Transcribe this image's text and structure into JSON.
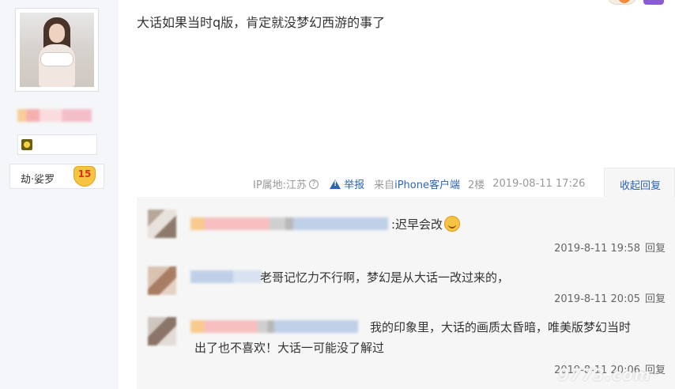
{
  "post": {
    "text": "大话如果当时q版，肯定就没梦幻西游的事了",
    "ip_location": "IP属地:江苏",
    "help_icon": "?",
    "report_label": "举报",
    "from_prefix": "来自",
    "client": "iPhone客户端",
    "floor": "2楼",
    "time": "2019-08-11 17:26",
    "collapse_label": "收起回复"
  },
  "user": {
    "level_name": "劫·娑罗",
    "level": "15",
    "avatar_icon": "user-avatar"
  },
  "replies": [
    {
      "text": ":迟早会改",
      "emoji_icon": "smile-icon",
      "time": "2019-8-11 19:58",
      "reply_label": "回复"
    },
    {
      "text": "老哥记忆力不行啊，梦幻是从大话一改过来的，",
      "time": "2019-8-11 20:05",
      "reply_label": "回复"
    },
    {
      "text_line1": "我的印象里，大话的画质太昏暗，唯美版梦幻当时",
      "text_line2": "出了也不喜欢！大话一可能没了解过",
      "time": "2019-8-11 20:06",
      "reply_label": "回复"
    }
  ],
  "watermark": "9773.com",
  "colors": {
    "link": "#2d64b3",
    "reply_bg": "#f6f6f6",
    "left_panel_bg": "#f4f6f9",
    "meta_text": "#999999"
  }
}
